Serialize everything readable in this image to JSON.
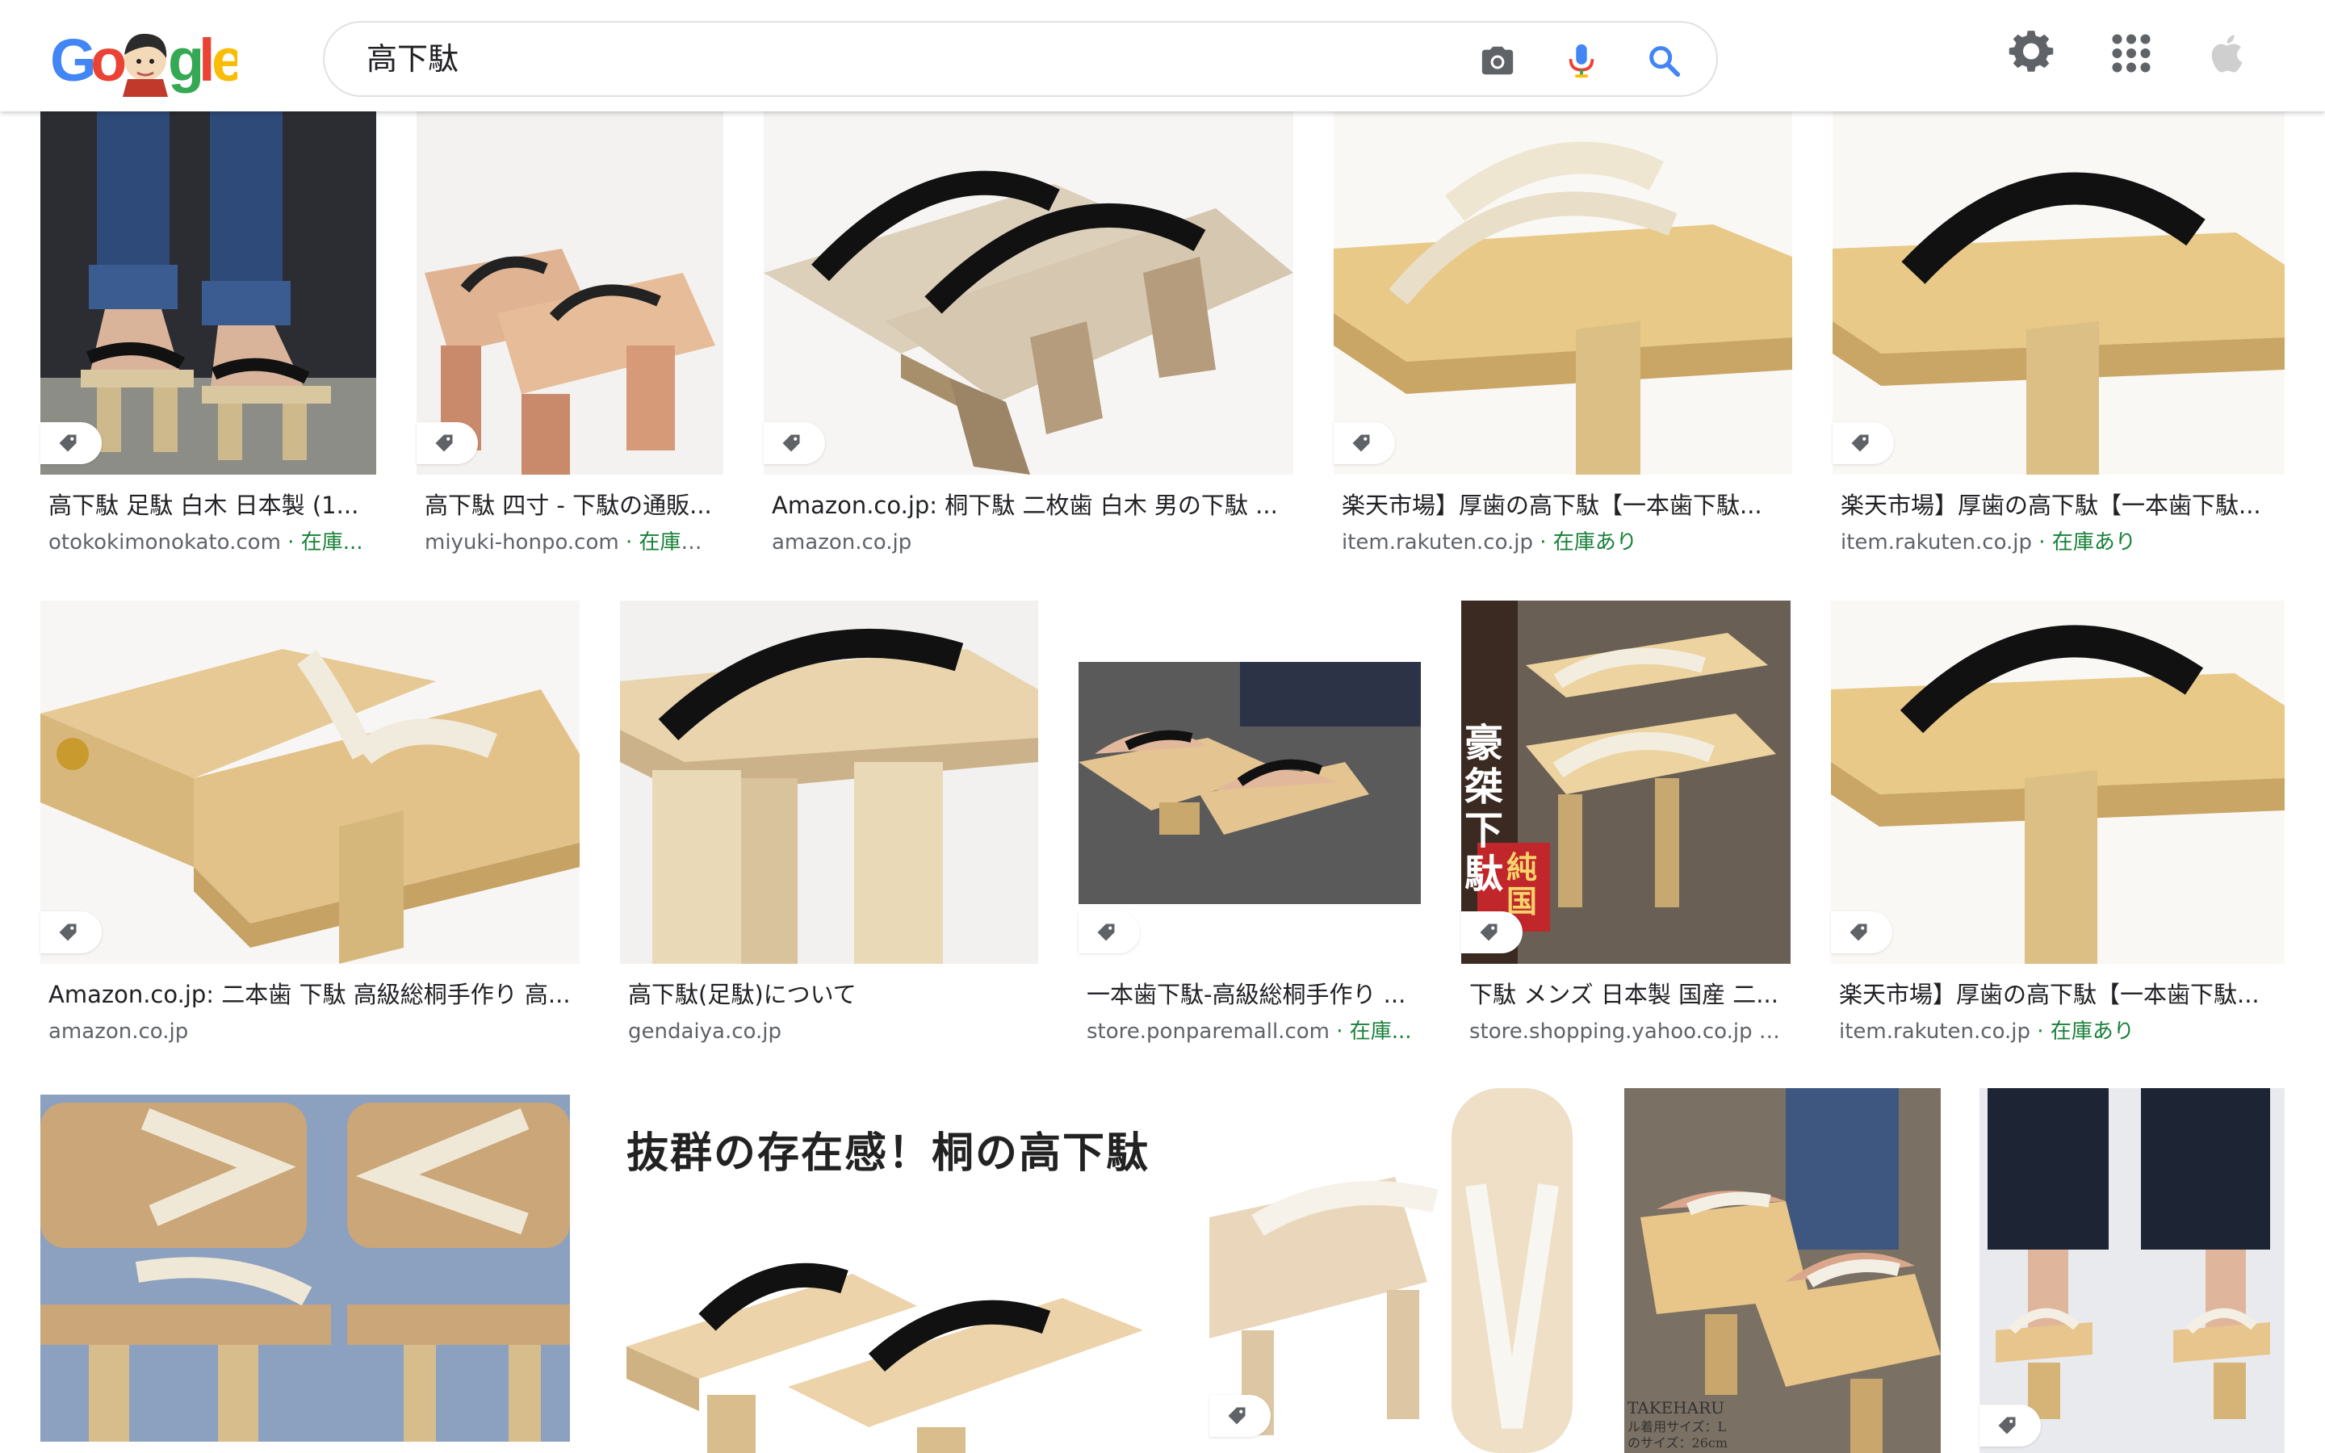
{
  "search": {
    "query": "高下駄"
  },
  "header": {
    "logo_letters": [
      "G",
      "o",
      "g",
      "l",
      "e"
    ],
    "icons": [
      "camera-icon",
      "microphone-icon",
      "search-icon",
      "settings-gear-icon",
      "apps-grid-icon",
      "account-avatar-icon"
    ]
  },
  "colors": {
    "blue": "#4285f4",
    "red": "#ea4335",
    "yellow": "#fbbc05",
    "green": "#34a853",
    "stock_green": "#188038",
    "source_gray": "#5f6368"
  },
  "results": [
    {
      "title": "高下駄 足駄 白木 日本製 (1...",
      "source": "otokokimonokato.com",
      "stock": " · 在庫..."
    },
    {
      "title": "高下駄 四寸 - 下駄の通販...",
      "source": "miyuki-honpo.com",
      "stock": " · 在庫あ..."
    },
    {
      "title": "Amazon.co.jp: 桐下駄 二枚歯 白木 男の下駄 ...",
      "source": "amazon.co.jp",
      "stock": ""
    },
    {
      "title": "楽天市場】厚歯の高下駄【一本歯下駄...",
      "source": "item.rakuten.co.jp",
      "stock": " · 在庫あり"
    },
    {
      "title": "楽天市場】厚歯の高下駄【一本歯下駄...",
      "source": "item.rakuten.co.jp",
      "stock": " · 在庫あり"
    },
    {
      "title": "Amazon.co.jp: 二本歯 下駄 高級総桐手作り 高...",
      "source": "amazon.co.jp",
      "stock": ""
    },
    {
      "title": "高下駄(足駄)について",
      "source": "gendaiya.co.jp",
      "stock": ""
    },
    {
      "title": "一本歯下駄-高級総桐手作り ...",
      "source": "store.ponparemall.com",
      "stock": " · 在庫..."
    },
    {
      "title": "下駄 メンズ 日本製 国産 二...",
      "source": "store.shopping.yahoo.co.jp",
      "stock": " · ..."
    },
    {
      "title": "楽天市場】厚歯の高下駄【一本歯下駄...",
      "source": "item.rakuten.co.jp",
      "stock": " · 在庫あり"
    }
  ],
  "image_text": {
    "banner": "抜群の存在感！桐の高下駄",
    "vertical_1": "豪桀下駄",
    "vertical_2": "純国",
    "credit_1": "TAKEHARU",
    "credit_2": "ル着用サイズ：L",
    "credit_3": "のサイズ：26cm"
  }
}
